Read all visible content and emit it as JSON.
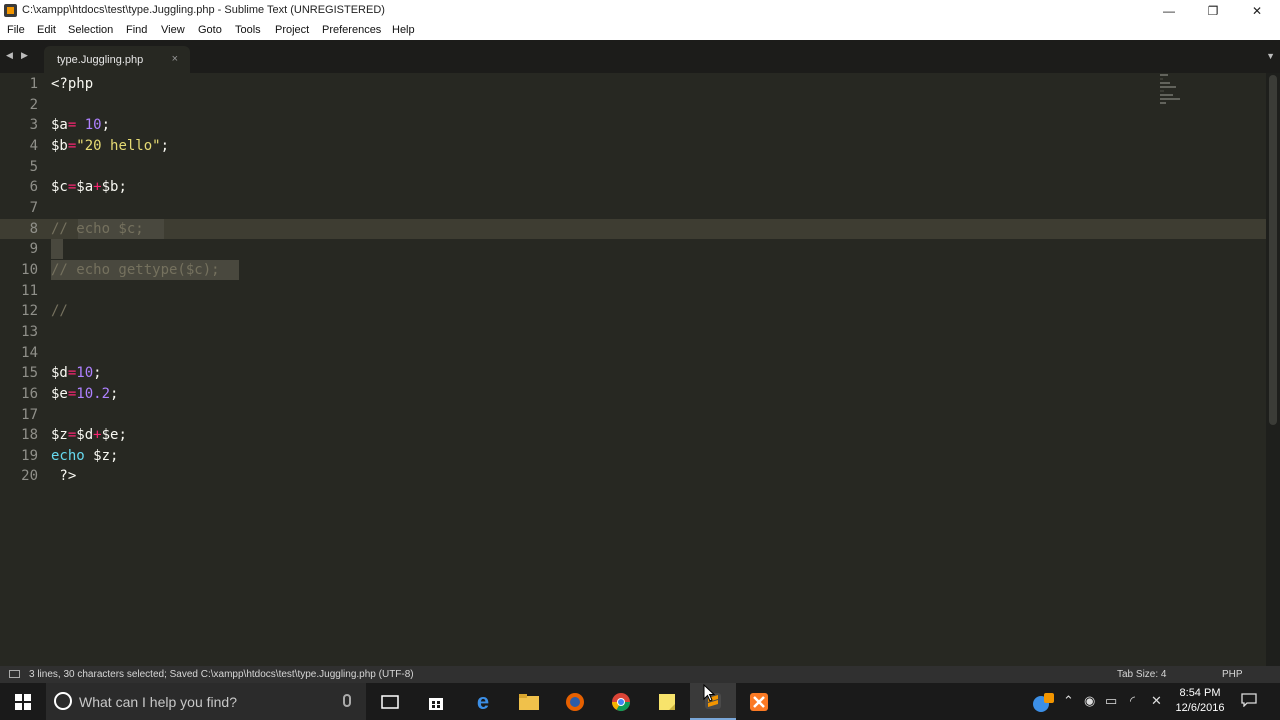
{
  "window": {
    "title": "C:\\xampp\\htdocs\\test\\type.Juggling.php - Sublime Text (UNREGISTERED)"
  },
  "menu": [
    "File",
    "Edit",
    "Selection",
    "Find",
    "View",
    "Goto",
    "Tools",
    "Project",
    "Preferences",
    "Help"
  ],
  "tab": {
    "label": "type.Juggling.php",
    "close": "×"
  },
  "lines": [
    "1",
    "2",
    "3",
    "4",
    "5",
    "6",
    "7",
    "8",
    "9",
    "10",
    "11",
    "12",
    "13",
    "14",
    "15",
    "16",
    "17",
    "18",
    "19",
    "20"
  ],
  "code": {
    "l1": "<?php",
    "l3": {
      "var": "$a",
      "op": "=",
      "sp": " ",
      "num": "10",
      "end": ";"
    },
    "l4": {
      "var": "$b",
      "op": "=",
      "str": "\"20 hello\"",
      "end": ";"
    },
    "l6": {
      "v1": "$c",
      "op1": "=",
      "v2": "$a",
      "op2": "+",
      "v3": "$b",
      "end": ";"
    },
    "l8": {
      "slashes": "//",
      "rest": " echo $c;"
    },
    "l10": "// echo gettype($c);",
    "l12": "//",
    "l15": {
      "var": "$d",
      "op": "=",
      "num": "10",
      "end": ";"
    },
    "l16": {
      "var": "$e",
      "op": "=",
      "num": "10.2",
      "end": ";"
    },
    "l18": {
      "v1": "$z",
      "op1": "=",
      "v2": "$d",
      "op2": "+",
      "v3": "$e",
      "end": ";"
    },
    "l19": {
      "kw": "echo",
      "rest": " $z;"
    },
    "l20": " ?>"
  },
  "status": {
    "message": "3 lines, 30 characters selected; Saved C:\\xampp\\htdocs\\test\\type.Juggling.php (UTF-8)",
    "tab_size": "Tab Size: 4",
    "syntax": "PHP"
  },
  "taskbar": {
    "search_placeholder": "What can I help you find?",
    "time": "8:54 PM",
    "date": "12/6/2016"
  },
  "colors": {
    "editor_bg": "#272822",
    "keyword": "#66d9ef",
    "operator": "#f92672",
    "number": "#ae81ff",
    "string": "#e6db74",
    "comment": "#75715e"
  }
}
